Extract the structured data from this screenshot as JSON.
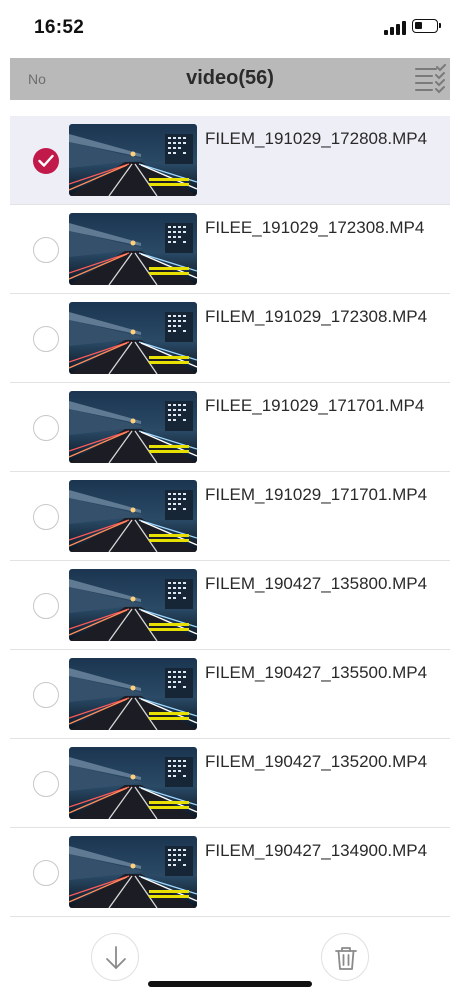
{
  "status_bar": {
    "time": "16:52",
    "signal_icon": "cellular-signal-icon",
    "battery_icon": "battery-low-icon"
  },
  "top_bar": {
    "left_label": "No",
    "title": "video(56)",
    "select_icon": "select-all-checklist-icon"
  },
  "files": [
    {
      "name": "FILEM_191029_172808.MP4",
      "selected": true
    },
    {
      "name": "FILEE_191029_172308.MP4",
      "selected": false
    },
    {
      "name": "FILEM_191029_172308.MP4",
      "selected": false
    },
    {
      "name": "FILEE_191029_171701.MP4",
      "selected": false
    },
    {
      "name": "FILEM_191029_171701.MP4",
      "selected": false
    },
    {
      "name": "FILEM_190427_135800.MP4",
      "selected": false
    },
    {
      "name": "FILEM_190427_135500.MP4",
      "selected": false
    },
    {
      "name": "FILEM_190427_135200.MP4",
      "selected": false
    },
    {
      "name": "FILEM_190427_134900.MP4",
      "selected": false
    }
  ],
  "bottom_bar": {
    "download_icon": "download-arrow-icon",
    "delete_icon": "trash-icon"
  },
  "colors": {
    "accent": "#c2194b",
    "top_bar_bg": "#b9b9b9",
    "selected_row_bg": "#eeeef6"
  }
}
